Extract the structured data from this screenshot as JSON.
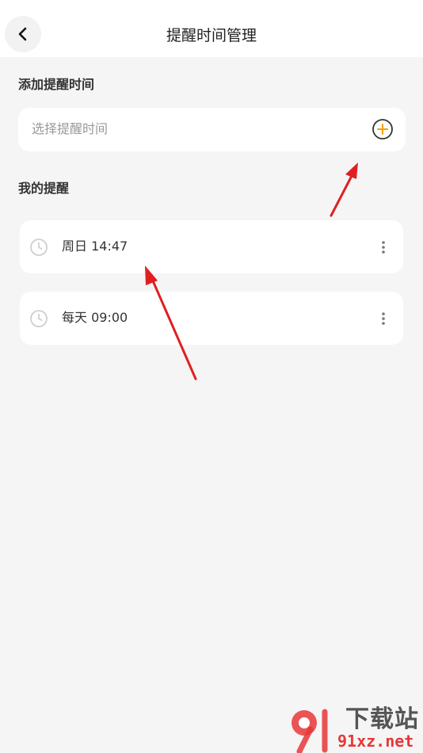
{
  "header": {
    "title": "提醒时间管理",
    "back_icon": "chevron-left-icon"
  },
  "add_section": {
    "label": "添加提醒时间",
    "placeholder": "选择提醒时间",
    "add_icon": "plus-circle-icon"
  },
  "my_reminders": {
    "label": "我的提醒",
    "items": [
      {
        "text": "周日 14:47",
        "icon": "clock-icon",
        "menu_icon": "more-vertical-icon"
      },
      {
        "text": "每天 09:00",
        "icon": "clock-icon",
        "menu_icon": "more-vertical-icon"
      }
    ]
  },
  "colors": {
    "accent": "#f5a000",
    "annotation": "#e02020",
    "background": "#f5f5f5"
  },
  "watermark": {
    "top": "下载站",
    "bottom": "91xz.net"
  }
}
